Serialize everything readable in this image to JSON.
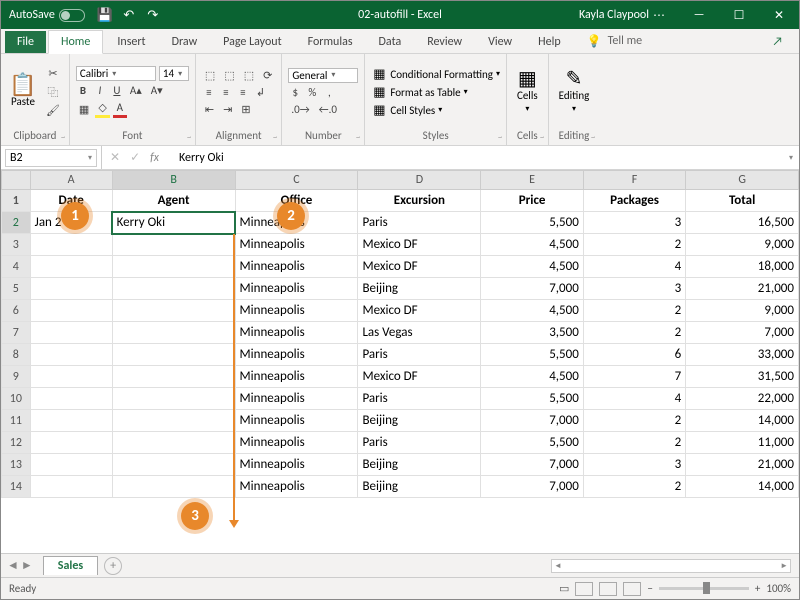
{
  "titlebar": {
    "autosave": "AutoSave",
    "title": "02-autofill - Excel",
    "user": "Kayla Claypool"
  },
  "tabs": {
    "file": "File",
    "home": "Home",
    "insert": "Insert",
    "draw": "Draw",
    "pagelayout": "Page Layout",
    "formulas": "Formulas",
    "data": "Data",
    "review": "Review",
    "view": "View",
    "help": "Help",
    "tellme": "Tell me"
  },
  "ribbon": {
    "clipboard": {
      "paste": "Paste",
      "label": "Clipboard"
    },
    "font": {
      "name": "Calibri",
      "size": "14",
      "label": "Font"
    },
    "alignment": {
      "label": "Alignment"
    },
    "number": {
      "format": "General",
      "label": "Number"
    },
    "styles": {
      "cond": "Conditional Formatting",
      "table": "Format as Table",
      "cell": "Cell Styles",
      "label": "Styles"
    },
    "cells": {
      "label": "Cells"
    },
    "editing": {
      "label": "Editing"
    }
  },
  "namebox": "B2",
  "formula": "Kerry Oki",
  "columns": [
    "A",
    "B",
    "C",
    "D",
    "E",
    "F",
    "G"
  ],
  "headers": [
    "Date",
    "Agent",
    "Office",
    "Excursion",
    "Price",
    "Packages",
    "Total"
  ],
  "rows": [
    {
      "n": 2,
      "date": "Jan 2",
      "agent": "Kerry Oki",
      "office": "Minneapolis",
      "exc": "Paris",
      "price": "5,500",
      "pkg": "3",
      "total": "16,500"
    },
    {
      "n": 3,
      "date": "",
      "agent": "",
      "office": "Minneapolis",
      "exc": "Mexico DF",
      "price": "4,500",
      "pkg": "2",
      "total": "9,000"
    },
    {
      "n": 4,
      "date": "",
      "agent": "",
      "office": "Minneapolis",
      "exc": "Mexico DF",
      "price": "4,500",
      "pkg": "4",
      "total": "18,000"
    },
    {
      "n": 5,
      "date": "",
      "agent": "",
      "office": "Minneapolis",
      "exc": "Beijing",
      "price": "7,000",
      "pkg": "3",
      "total": "21,000"
    },
    {
      "n": 6,
      "date": "",
      "agent": "",
      "office": "Minneapolis",
      "exc": "Mexico DF",
      "price": "4,500",
      "pkg": "2",
      "total": "9,000"
    },
    {
      "n": 7,
      "date": "",
      "agent": "",
      "office": "Minneapolis",
      "exc": "Las Vegas",
      "price": "3,500",
      "pkg": "2",
      "total": "7,000"
    },
    {
      "n": 8,
      "date": "",
      "agent": "",
      "office": "Minneapolis",
      "exc": "Paris",
      "price": "5,500",
      "pkg": "6",
      "total": "33,000"
    },
    {
      "n": 9,
      "date": "",
      "agent": "",
      "office": "Minneapolis",
      "exc": "Mexico DF",
      "price": "4,500",
      "pkg": "7",
      "total": "31,500"
    },
    {
      "n": 10,
      "date": "",
      "agent": "",
      "office": "Minneapolis",
      "exc": "Paris",
      "price": "5,500",
      "pkg": "4",
      "total": "22,000"
    },
    {
      "n": 11,
      "date": "",
      "agent": "",
      "office": "Minneapolis",
      "exc": "Beijing",
      "price": "7,000",
      "pkg": "2",
      "total": "14,000"
    },
    {
      "n": 12,
      "date": "",
      "agent": "",
      "office": "Minneapolis",
      "exc": "Paris",
      "price": "5,500",
      "pkg": "2",
      "total": "11,000"
    },
    {
      "n": 13,
      "date": "",
      "agent": "",
      "office": "Minneapolis",
      "exc": "Beijing",
      "price": "7,000",
      "pkg": "3",
      "total": "21,000"
    },
    {
      "n": 14,
      "date": "",
      "agent": "",
      "office": "Minneapolis",
      "exc": "Beijing",
      "price": "7,000",
      "pkg": "2",
      "total": "14,000"
    }
  ],
  "sheet_tab": "Sales",
  "status": {
    "ready": "Ready",
    "zoom": "100%"
  },
  "callouts": {
    "c1": "1",
    "c2": "2",
    "c3": "3"
  }
}
